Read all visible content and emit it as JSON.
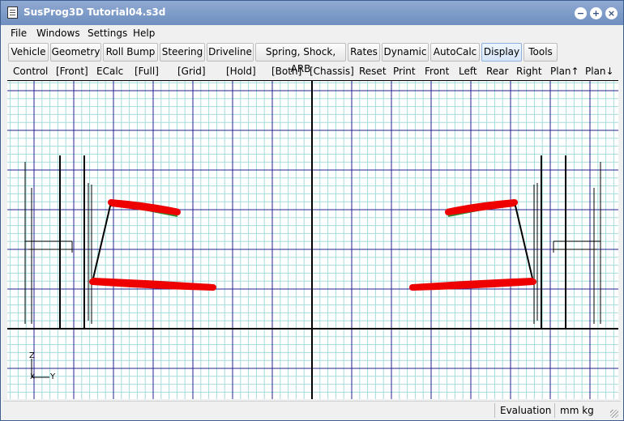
{
  "window": {
    "title": "SusProg3D Tutorial04.s3d"
  },
  "window_controls": {
    "minimize": "−",
    "maximize": "+",
    "close": "×"
  },
  "menu": {
    "items": [
      "File",
      "Windows",
      "Settings",
      "Help"
    ]
  },
  "toolbar": {
    "tabs": [
      "Vehicle",
      "Geometry",
      "Roll Bump",
      "Steering",
      "Driveline",
      "Spring, Shock, ARB",
      "Rates",
      "Dynamic",
      "AutoCalc",
      "Display",
      "Tools"
    ],
    "active": "Display"
  },
  "commands": [
    "Control",
    "[Front]",
    "ECalc",
    "[Full]",
    "[Grid]",
    "[Hold]",
    "[Both]",
    "[Chassis]",
    "Reset",
    "Print",
    "Front",
    "Left",
    "Rear",
    "Right",
    "Plan↑",
    "Plan↓"
  ],
  "viewport": {
    "axis_labels": {
      "z": "Z",
      "x": "X",
      "y": "Y"
    },
    "colors": {
      "fine_grid": "#a6dcdc",
      "major_grid": "#23238f",
      "arms": "#ee0000",
      "structure": "#000000",
      "joint_green": "#2e8b2e"
    }
  },
  "status": {
    "mode": "Evaluation",
    "units": "mm kg"
  }
}
